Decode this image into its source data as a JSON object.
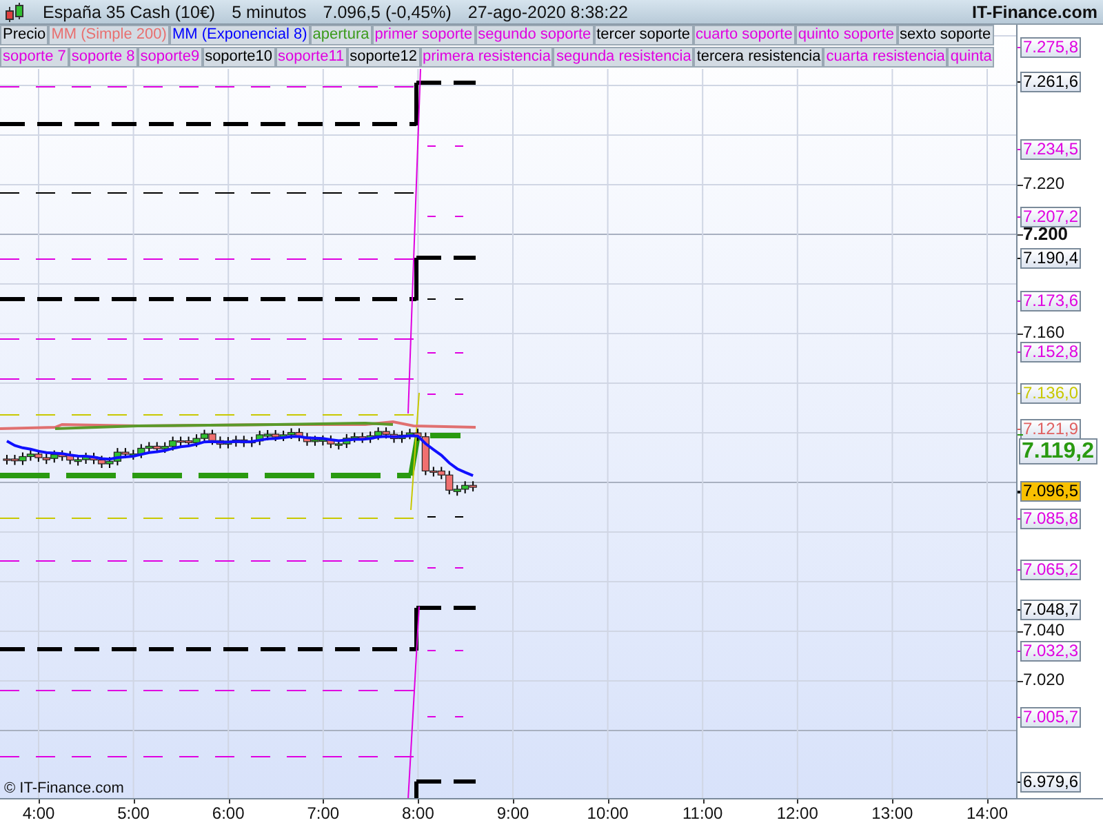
{
  "header": {
    "instrument": "España 35 Cash (10€)",
    "timeframe": "5 minutos",
    "quote": "7.096,5 (-0,45%)",
    "datetime": "27-ago-2020 8:38:22",
    "brand": "IT-Finance.com"
  },
  "legend": {
    "items": [
      {
        "label": "Precio",
        "color": "#000000"
      },
      {
        "label": "MM (Simple 200)",
        "color": "#e87070"
      },
      {
        "label": "MM (Exponencial 8)",
        "color": "#0000ff"
      },
      {
        "label": "apertura",
        "color": "#3a9a1a"
      },
      {
        "label": "primer soporte",
        "color": "#e000e0"
      },
      {
        "label": "segundo soporte",
        "color": "#e000e0"
      },
      {
        "label": "tercer soporte",
        "color": "#000000"
      },
      {
        "label": "cuarto soporte",
        "color": "#e000e0"
      },
      {
        "label": "quinto soporte",
        "color": "#e000e0"
      },
      {
        "label": "sexto soporte",
        "color": "#000000"
      },
      {
        "label": "soporte 7",
        "color": "#e000e0"
      },
      {
        "label": "soporte 8",
        "color": "#e000e0"
      },
      {
        "label": "soporte9",
        "color": "#e000e0"
      },
      {
        "label": "soporte10",
        "color": "#000000"
      },
      {
        "label": "soporte11",
        "color": "#e000e0"
      },
      {
        "label": "soporte12",
        "color": "#000000"
      },
      {
        "label": "primera resistencia",
        "color": "#e000e0"
      },
      {
        "label": "segunda resistencia",
        "color": "#e000e0"
      },
      {
        "label": "tercera resistencia",
        "color": "#000000"
      },
      {
        "label": "cuarta resistencia",
        "color": "#e000e0"
      },
      {
        "label": "quinta",
        "color": "#e000e0"
      }
    ]
  },
  "price_axis": {
    "ticks": [
      "7.220",
      "7.200",
      "7.160",
      "7.040",
      "7.020"
    ],
    "tags": [
      {
        "text": "7.275,8",
        "color": "#e000e0",
        "kind": "tag"
      },
      {
        "text": "7.261,6",
        "color": "#000000",
        "kind": "tag"
      },
      {
        "text": "7.234,5",
        "color": "#e000e0",
        "kind": "tag"
      },
      {
        "text": "7.207,2",
        "color": "#e000e0",
        "kind": "tag"
      },
      {
        "text": "7.190,4",
        "color": "#000000",
        "kind": "tag"
      },
      {
        "text": "7.173,6",
        "color": "#e000e0",
        "kind": "tag"
      },
      {
        "text": "7.152,8",
        "color": "#e000e0",
        "kind": "tag"
      },
      {
        "text": "7.136,0",
        "color": "#c8c800",
        "kind": "tag"
      },
      {
        "text": "7.121,9",
        "color": "#e06060",
        "kind": "tag"
      },
      {
        "text": "7.119,2",
        "color": "#2a9a10",
        "kind": "big"
      },
      {
        "text": "7.096,5",
        "color": "#000000",
        "kind": "current"
      },
      {
        "text": "7.085,8",
        "color": "#e000e0",
        "kind": "tag"
      },
      {
        "text": "7.065,2",
        "color": "#e000e0",
        "kind": "tag"
      },
      {
        "text": "7.048,7",
        "color": "#000000",
        "kind": "tag"
      },
      {
        "text": "7.032,3",
        "color": "#e000e0",
        "kind": "tag"
      },
      {
        "text": "7.005,7",
        "color": "#e000e0",
        "kind": "tag"
      },
      {
        "text": "6.979,6",
        "color": "#000000",
        "kind": "tag"
      }
    ]
  },
  "time_axis": {
    "labels": [
      "4:00",
      "5:00",
      "6:00",
      "7:00",
      "8:00",
      "9:00",
      "10:00",
      "11:00",
      "12:00",
      "13:00",
      "14:00"
    ]
  },
  "copyright": "© IT-Finance.com"
}
